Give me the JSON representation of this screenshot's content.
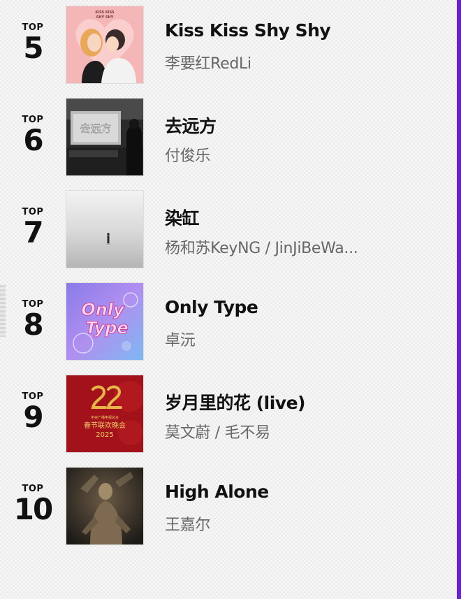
{
  "rank_label": "TOP",
  "entries": [
    {
      "rank": "5",
      "title": "Kiss Kiss Shy Shy",
      "artist": "李要红RedLi",
      "cover_text": [
        "KISS KISS",
        "SHY SHY"
      ]
    },
    {
      "rank": "6",
      "title": "去远方",
      "artist": "付俊乐",
      "cover_text": [
        "去远方"
      ]
    },
    {
      "rank": "7",
      "title": "染缸",
      "artist": "杨和苏KeyNG / JinJiBeWa...",
      "cover_text": []
    },
    {
      "rank": "8",
      "title": "Only Type",
      "artist": "卓沅",
      "cover_text": [
        "Only",
        "Type"
      ]
    },
    {
      "rank": "9",
      "title": "岁月里的花 (live)",
      "artist": "莫文蔚 / 毛不易",
      "cover_text": [
        "中央广播电视总台",
        "春节联欢晚会",
        "2025"
      ]
    },
    {
      "rank": "10",
      "title": "High Alone",
      "artist": "王嘉尔",
      "cover_text": []
    }
  ],
  "colors": {
    "accent_bar": "#6a1fd0",
    "title_text": "#111111",
    "artist_text": "#666666"
  }
}
